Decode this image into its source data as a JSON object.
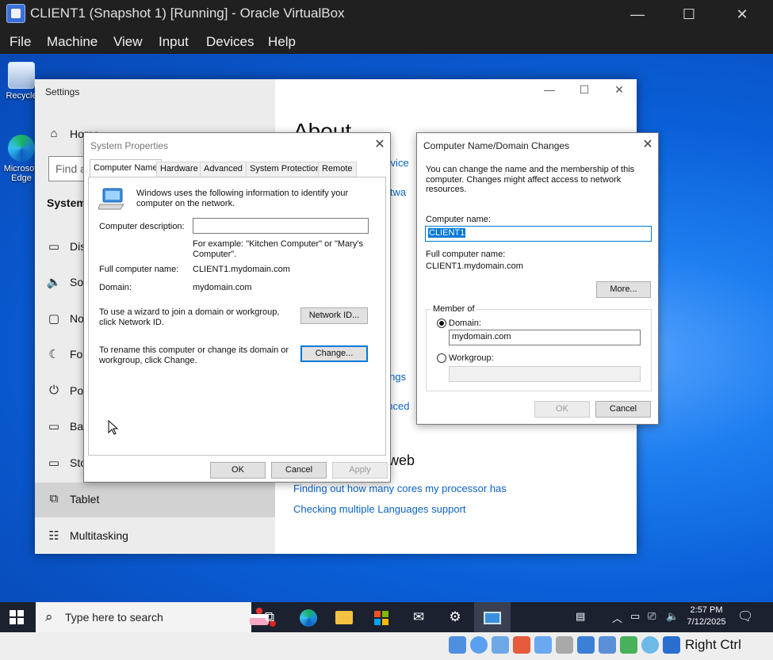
{
  "vbox": {
    "title": "CLIENT1  (Snapshot 1) [Running] - Oracle VirtualBox",
    "menu": [
      "File",
      "Machine",
      "View",
      "Input",
      "Devices",
      "Help"
    ],
    "minimize": "—",
    "maximize": "☐",
    "close": "✕",
    "host_key": "Right Ctrl"
  },
  "desktop_icons": [
    {
      "label": "Recycle",
      "icon": "recycle-bin-icon"
    },
    {
      "label": "Microsoft Edge",
      "icon": "edge-icon"
    }
  ],
  "settings": {
    "title": "Settings",
    "search_placeholder": "Find a",
    "section": "System",
    "nav": [
      {
        "label": "Home",
        "icon": "home-icon"
      },
      {
        "label": "Dis",
        "icon": "display-icon"
      },
      {
        "label": "So",
        "icon": "sound-icon"
      },
      {
        "label": "No",
        "icon": "notifications-icon"
      },
      {
        "label": "Fo",
        "icon": "focus-assist-icon"
      },
      {
        "label": "Po",
        "icon": "power-icon"
      },
      {
        "label": "Bat",
        "icon": "battery-icon"
      },
      {
        "label": "Sto",
        "icon": "storage-icon"
      },
      {
        "label": "Tablet",
        "icon": "tablet-icon"
      },
      {
        "label": "Multitasking",
        "icon": "multitasking-icon"
      }
    ],
    "about_title": "About",
    "right_fragments": [
      "ervice",
      "oftwa",
      "s",
      "ttings",
      "anced"
    ],
    "web_heading": "web",
    "links": [
      "Finding out how many cores my processor has",
      "Checking multiple Languages support"
    ]
  },
  "system_properties": {
    "title": "System Properties",
    "tabs": [
      "Computer Name",
      "Hardware",
      "Advanced",
      "System Protection",
      "Remote"
    ],
    "intro": "Windows uses the following information to identify your computer on the network.",
    "description_label": "Computer description:",
    "description_value": "",
    "example": "For example: \"Kitchen Computer\" or \"Mary's Computer\".",
    "full_name_label": "Full computer name:",
    "full_name_value": "CLIENT1.mydomain.com",
    "domain_label": "Domain:",
    "domain_value": "mydomain.com",
    "wizard_text": "To use a wizard to join a domain or workgroup, click Network ID.",
    "network_id_button": "Network ID...",
    "rename_text": "To rename this computer or change its domain or workgroup, click Change.",
    "change_button": "Change...",
    "ok": "OK",
    "cancel": "Cancel",
    "apply": "Apply"
  },
  "name_changes": {
    "title": "Computer Name/Domain Changes",
    "intro": "You can change the name and the membership of this computer. Changes might affect access to network resources.",
    "computer_name_label": "Computer name:",
    "computer_name_value": "CLIENT1",
    "full_name_label": "Full computer name:",
    "full_name_value": "CLIENT1.mydomain.com",
    "more_button": "More...",
    "member_of": "Member of",
    "domain_label": "Domain:",
    "domain_value": "mydomain.com",
    "workgroup_label": "Workgroup:",
    "workgroup_value": "",
    "selected_membership": "domain",
    "ok": "OK",
    "cancel": "Cancel"
  },
  "taskbar": {
    "search_placeholder": "Type here to search",
    "apps": [
      "task-view-icon",
      "edge-icon",
      "file-explorer-icon",
      "store-icon",
      "mail-icon",
      "settings-gear-icon",
      "system-properties-icon"
    ],
    "time": "2:57 PM",
    "date": "7/12/2025"
  }
}
